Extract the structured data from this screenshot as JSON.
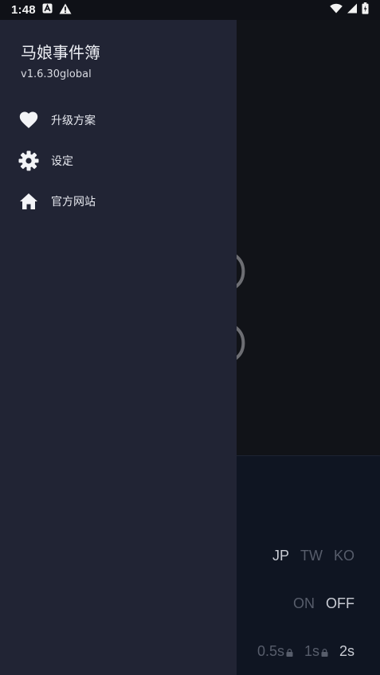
{
  "status_bar": {
    "time": "1:48",
    "icons": [
      "a-notification-icon",
      "warning-icon",
      "wifi-icon",
      "signal-icon",
      "battery-icon"
    ]
  },
  "drawer": {
    "title": "马娘事件簿",
    "version": "v1.6.30global",
    "items": [
      {
        "label": "升级方案",
        "icon": "heart-icon"
      },
      {
        "label": "设定",
        "icon": "gear-icon"
      },
      {
        "label": "官方网站",
        "icon": "home-icon"
      }
    ]
  },
  "background": {
    "languages": [
      "JP",
      "TW",
      "KO"
    ],
    "selected_language": "JP",
    "toggle": [
      "ON",
      "OFF"
    ],
    "selected_toggle": "OFF",
    "speeds": [
      "0.5s",
      "1s",
      "2s"
    ],
    "selected_speed": "2s"
  },
  "colors": {
    "drawer_bg": "#212434",
    "scrim_bg": "#111318",
    "text_primary": "#eceef3"
  }
}
